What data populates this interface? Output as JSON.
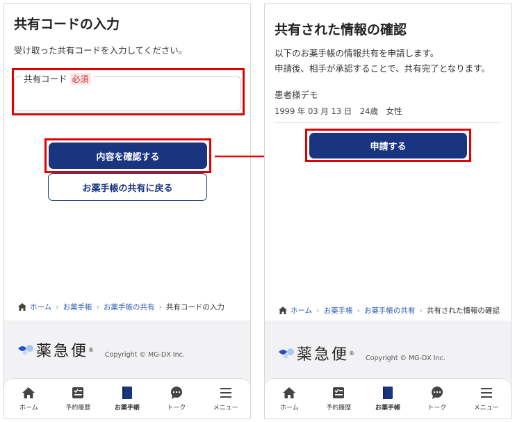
{
  "left": {
    "title": "共有コードの入力",
    "description": "受け取った共有コードを入力してください。",
    "field_label": "共有コード",
    "required_badge": "必須",
    "input_value": "",
    "confirm_button": "内容を確認する",
    "back_button": "お薬手帳の共有に戻る",
    "breadcrumb": [
      "ホーム",
      "お薬手帳",
      "お薬手帳の共有",
      "共有コードの入力"
    ]
  },
  "right": {
    "title": "共有された情報の確認",
    "description_line1": "以下のお薬手帳の情報共有を申請します。",
    "description_line2": "申請後、相手が承認することで、共有完了となります。",
    "patient_name": "患者様デモ",
    "patient_info": "1999 年 03 月 13 日　24歳　女性",
    "apply_button": "申請する",
    "breadcrumb": [
      "ホーム",
      "お薬手帳",
      "お薬手帳の共有",
      "共有された情報の確認"
    ]
  },
  "footer": {
    "logo_text": "薬急便",
    "logo_mark": "®",
    "copyright": "Copyright © MG-DX Inc."
  },
  "tabs": [
    {
      "label": "ホーム",
      "icon": "home-icon"
    },
    {
      "label": "予約履歴",
      "icon": "history-icon"
    },
    {
      "label": "お薬手帳",
      "icon": "notebook-icon",
      "active": true
    },
    {
      "label": "トーク",
      "icon": "chat-icon"
    },
    {
      "label": "メニュー",
      "icon": "menu-icon"
    }
  ],
  "colors": {
    "primary": "#1a3580",
    "highlight": "#e00000",
    "required": "#d03030",
    "link": "#2d5cb0"
  }
}
